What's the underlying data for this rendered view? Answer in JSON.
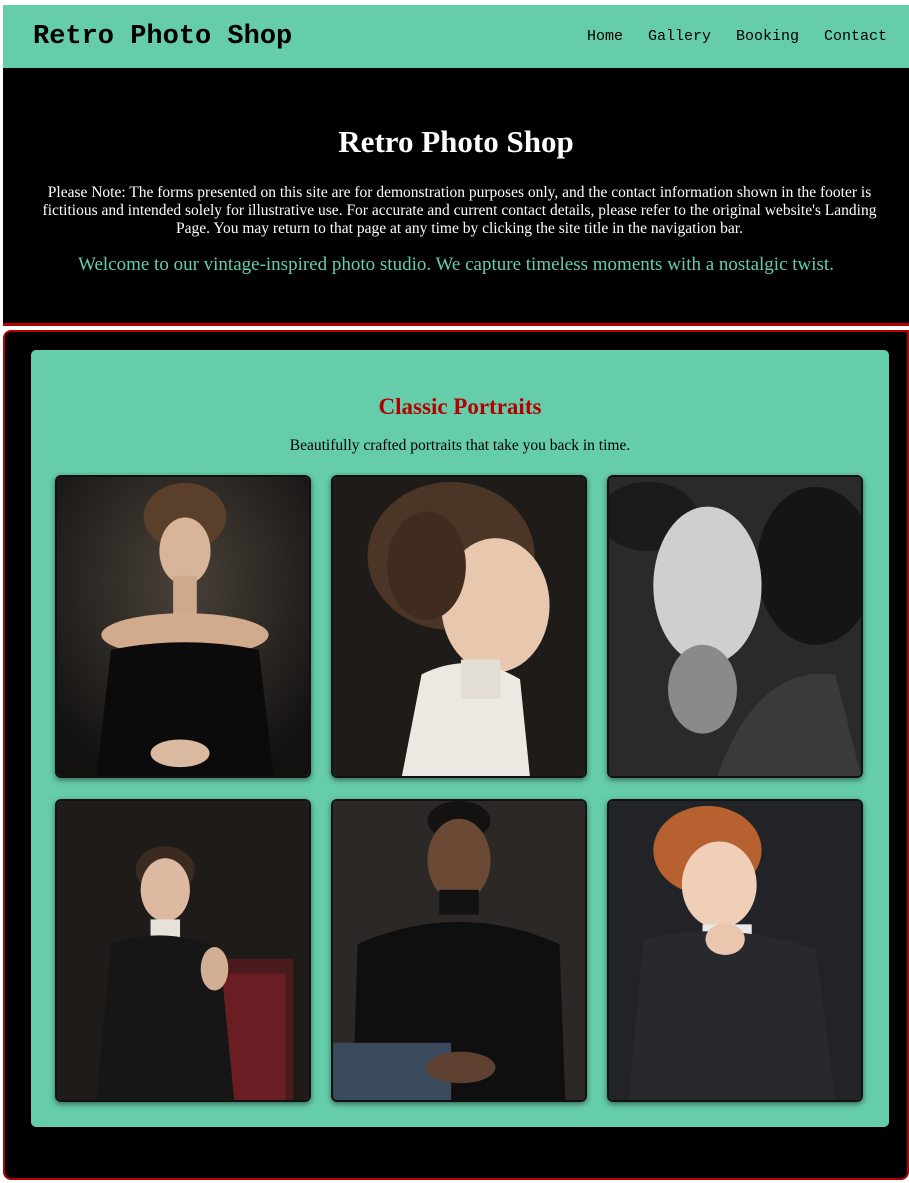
{
  "nav": {
    "site_title": "Retro Photo Shop",
    "links": [
      "Home",
      "Gallery",
      "Booking",
      "Contact"
    ]
  },
  "hero": {
    "title": "Retro Photo Shop",
    "note": "Please Note: The forms presented on this site are for demonstration purposes only, and the contact information shown in the footer is fictitious and intended solely for illustrative use. For accurate and current contact details, please refer to the original website's Landing Page. You may return to that page at any time by clicking the site title in the navigation bar.",
    "welcome": "Welcome to our vintage-inspired photo studio. We capture timeless moments with a nostalgic twist."
  },
  "gallery": {
    "heading": "Classic Portraits",
    "subheading": "Beautifully crafted portraits that take you back in time.",
    "photos": [
      {
        "name": "portrait-woman-black-dress"
      },
      {
        "name": "portrait-child-lace-collar"
      },
      {
        "name": "portrait-woman-black-white"
      },
      {
        "name": "portrait-man-vintage-chair"
      },
      {
        "name": "portrait-man-black-turtleneck"
      },
      {
        "name": "portrait-boy-suit"
      }
    ]
  },
  "colors": {
    "accent": "#66cdaa",
    "heading_red": "#b30000",
    "background": "#000000"
  }
}
